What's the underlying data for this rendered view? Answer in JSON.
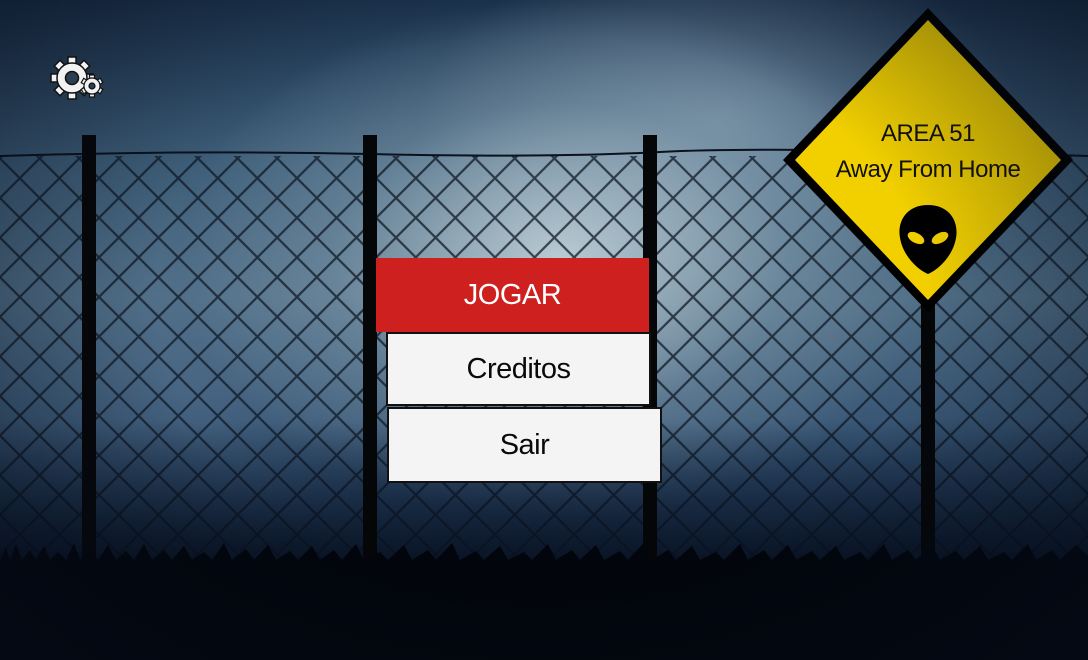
{
  "menu": {
    "play_label": "JOGAR",
    "credits_label": "Creditos",
    "exit_label": "Sair"
  },
  "settings": {
    "icon": "gear-icon"
  },
  "sign": {
    "line1": "AREA 51",
    "line2": "Away From Home",
    "icon": "alien-head-icon"
  },
  "colors": {
    "play_button": "#cf2020",
    "secondary_button": "#f4f4f4",
    "sign_yellow": "#f2d000",
    "sky_dark": "#1d3550"
  }
}
